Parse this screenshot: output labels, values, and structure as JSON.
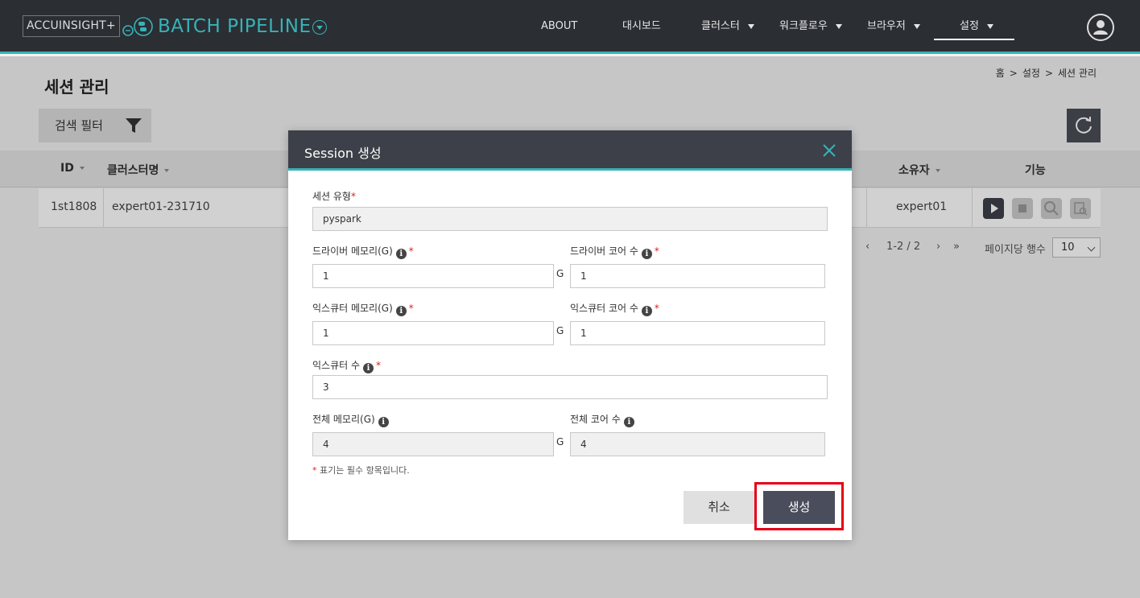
{
  "header": {
    "brand": "ACCUINSIGHT+",
    "product": "BATCH PIPELINE",
    "nav": [
      {
        "label": "ABOUT",
        "has_dropdown": false
      },
      {
        "label": "대시보드",
        "has_dropdown": false
      },
      {
        "label": "클러스터",
        "has_dropdown": true
      },
      {
        "label": "워크플로우",
        "has_dropdown": true
      },
      {
        "label": "브라우저",
        "has_dropdown": true
      },
      {
        "label": "설정",
        "has_dropdown": true,
        "active": true
      }
    ]
  },
  "page": {
    "title": "세션 관리",
    "breadcrumb": [
      "홈",
      "설정",
      "세션 관리"
    ],
    "filter_label": "검색 필터"
  },
  "table": {
    "columns": [
      "ID",
      "클러스터명",
      "소유자",
      "기능"
    ],
    "rows": [
      {
        "id": "1st1808",
        "cluster": "expert01-231710",
        "owner": "expert01"
      }
    ]
  },
  "pagination": {
    "range": "1-2",
    "sep": "/",
    "total": "2",
    "per_page_label": "페이지당 행수",
    "per_page": "10"
  },
  "modal": {
    "title": "Session 생성",
    "session_type_label": "세션 유형",
    "session_type_value": "pyspark",
    "driver_memory_label": "드라이버 메모리(G)",
    "driver_memory_value": "1",
    "driver_cores_label": "드라이버 코어 수",
    "driver_cores_value": "1",
    "executor_memory_label": "익스큐터 메모리(G)",
    "executor_memory_value": "1",
    "executor_cores_label": "익스큐터 코어 수",
    "executor_cores_value": "1",
    "executor_count_label": "익스큐터 수",
    "executor_count_value": "3",
    "total_memory_label": "전체 메모리(G)",
    "total_memory_value": "4",
    "total_cores_label": "전체 코어 수",
    "total_cores_value": "4",
    "unit": "G",
    "required_mark": "*",
    "note": "표기는 필수 항목입니다.",
    "cancel_label": "취소",
    "create_label": "생성"
  },
  "colors": {
    "accent": "#36b3b8",
    "header_bg": "#2b2e33",
    "required": "#d9231d",
    "highlight": "#e60012"
  },
  "icons": [
    "user-icon",
    "filter-icon",
    "refresh-icon",
    "play-icon",
    "stop-icon",
    "search-icon",
    "detail-icon",
    "close-icon",
    "info-icon"
  ]
}
